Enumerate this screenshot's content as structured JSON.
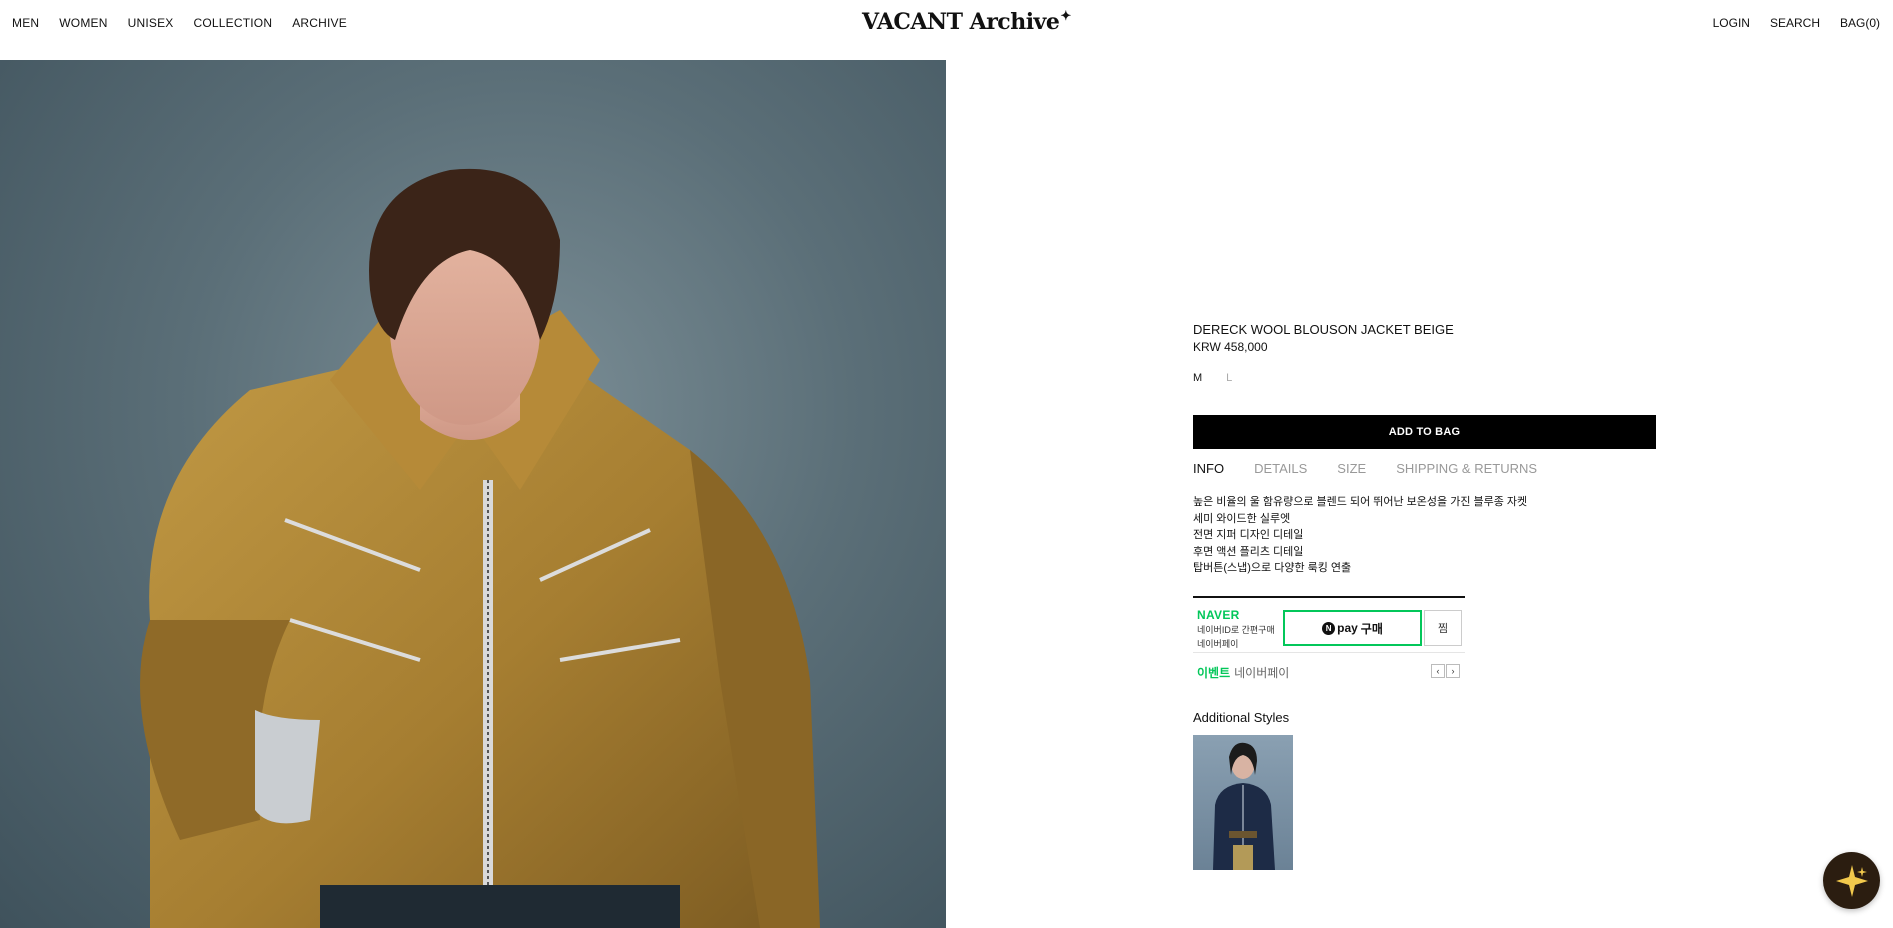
{
  "header": {
    "nav_left": [
      "MEN",
      "WOMEN",
      "UNISEX",
      "COLLECTION",
      "ARCHIVE"
    ],
    "logo": "VACANT Archive",
    "nav_right": [
      "LOGIN",
      "SEARCH",
      "BAG(0)"
    ]
  },
  "product": {
    "title": "DERECK WOOL BLOUSON JACKET BEIGE",
    "price": "KRW 458,000",
    "sizes": [
      {
        "label": "M",
        "available": true
      },
      {
        "label": "L",
        "available": false
      }
    ],
    "add_to_bag": "ADD TO BAG",
    "tabs": [
      "INFO",
      "DETAILS",
      "SIZE",
      "SHIPPING & RETURNS"
    ],
    "active_tab": "INFO",
    "info_lines": [
      "높은 비율의 울 함유량으로 블렌드 되어 뛰어난 보온성을 가진 블루종 자켓",
      "세미 와이드한 실루엣",
      "전면 지퍼 디자인 디테일",
      "후면 액션 플리츠 디테일",
      "탑버튼(스냅)으로 다양한 룩킹 연출"
    ]
  },
  "naver_pay": {
    "brand": "NAVER",
    "sub_line1": "네이버ID로 간편구매",
    "sub_line2": "네이버페이",
    "pay_label": "pay",
    "buy_label": "구매",
    "wish_label": "찜",
    "event_label": "이벤트",
    "event_name": "네이버페이",
    "brand_color": "#03c75a"
  },
  "additional": {
    "title": "Additional Styles"
  },
  "icons": {
    "chat": "sparkle-icon",
    "prev": "chevron-left-icon",
    "next": "chevron-right-icon"
  }
}
